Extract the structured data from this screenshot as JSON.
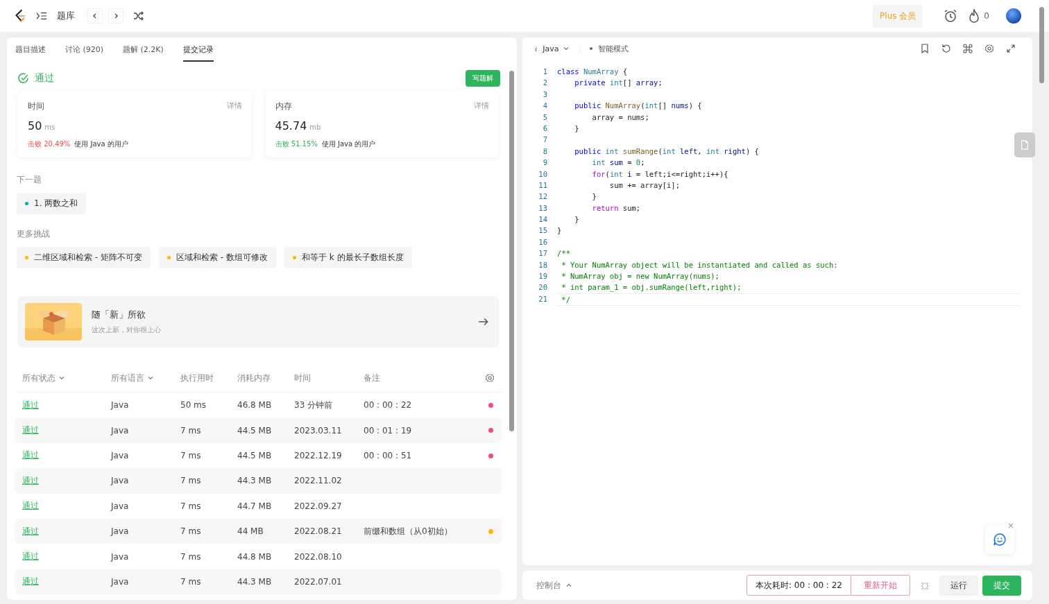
{
  "topbar": {
    "breadcrumb": "题库",
    "plus": "Plus 会员",
    "streak": "0"
  },
  "tabs": [
    {
      "label": "题目描述",
      "selected": false
    },
    {
      "label": "讨论 (920)",
      "selected": false
    },
    {
      "label": "题解 (2.2K)",
      "selected": false
    },
    {
      "label": "提交记录",
      "selected": true
    }
  ],
  "result": {
    "status": "通过",
    "write_button": "写题解"
  },
  "stats": [
    {
      "title": "时间",
      "detail": "详情",
      "value": "50",
      "unit": "ms",
      "beat": "击败 20.49%",
      "color": "#f04b4b",
      "suffix": "使用 Java 的用户"
    },
    {
      "title": "内存",
      "detail": "详情",
      "value": "45.74",
      "unit": "mb",
      "beat": "击败 51.15%",
      "color": "#2db55d",
      "suffix": "使用 Java 的用户"
    }
  ],
  "next": {
    "heading": "下一题",
    "items": [
      {
        "label": "1. 两数之和",
        "color": "#00af9b"
      }
    ]
  },
  "more": {
    "heading": "更多挑战",
    "items": [
      {
        "label": "二维区域和检索 - 矩阵不可变",
        "color": "#ffb800"
      },
      {
        "label": "区域和检索 - 数组可修改",
        "color": "#ffb800"
      },
      {
        "label": "和等于 k 的最长子数组长度",
        "color": "#ffb800"
      }
    ]
  },
  "promo": {
    "title": "随「新」所欲",
    "subtitle": "这次上新，对你很上心"
  },
  "table": {
    "columns": [
      "所有状态",
      "所有语言",
      "执行用时",
      "消耗内存",
      "时间",
      "备注"
    ],
    "rows": [
      {
        "status": "通过",
        "lang": "Java",
        "runtime": "50 ms",
        "memory": "46.8 MB",
        "time": "33 分钟前",
        "note": "00 : 00 : 22",
        "color": "#ef4b8c"
      },
      {
        "status": "通过",
        "lang": "Java",
        "runtime": "7 ms",
        "memory": "44.5 MB",
        "time": "2023.03.11",
        "note": "00 : 01 : 19",
        "color": "#ef4b8c"
      },
      {
        "status": "通过",
        "lang": "Java",
        "runtime": "7 ms",
        "memory": "44.5 MB",
        "time": "2022.12.19",
        "note": "00 : 00 : 51",
        "color": "#ef4b8c"
      },
      {
        "status": "通过",
        "lang": "Java",
        "runtime": "7 ms",
        "memory": "44.3 MB",
        "time": "2022.11.02"
      },
      {
        "status": "通过",
        "lang": "Java",
        "runtime": "7 ms",
        "memory": "44.7 MB",
        "time": "2022.09.27"
      },
      {
        "status": "通过",
        "lang": "Java",
        "runtime": "7 ms",
        "memory": "44 MB",
        "time": "2022.08.21",
        "note": "前缀和数组（从0初始）",
        "color": "#ffb800"
      },
      {
        "status": "通过",
        "lang": "Java",
        "runtime": "7 ms",
        "memory": "44.8 MB",
        "time": "2022.08.10"
      },
      {
        "status": "通过",
        "lang": "Java",
        "runtime": "7 ms",
        "memory": "44.3 MB",
        "time": "2022.07.01"
      }
    ]
  },
  "editor": {
    "info_mark": "i",
    "language": "Java",
    "mode": "智能模式",
    "lines": [
      {
        "number": "1",
        "tokens": [
          {
            "t": "class ",
            "kind": "kw"
          },
          {
            "t": "NumArray",
            "kind": "type"
          },
          {
            "t": " {",
            "kind": "p"
          }
        ]
      },
      {
        "number": "2",
        "tokens": [
          {
            "t": "    private ",
            "kind": "kw"
          },
          {
            "t": "int",
            "kind": "type"
          },
          {
            "t": "[] ",
            "kind": "p"
          },
          {
            "t": "array",
            "kind": "var"
          },
          {
            "t": ";",
            "kind": "p"
          }
        ]
      },
      {
        "number": "3"
      },
      {
        "number": "4",
        "tokens": [
          {
            "t": "    public ",
            "kind": "kw"
          },
          {
            "t": "NumArray",
            "kind": "fn"
          },
          {
            "t": "(",
            "kind": "p"
          },
          {
            "t": "int",
            "kind": "type"
          },
          {
            "t": "[] ",
            "kind": "p"
          },
          {
            "t": "nums",
            "kind": "var"
          },
          {
            "t": ") {",
            "kind": "p"
          }
        ]
      },
      {
        "number": "5",
        "tokens": [
          {
            "t": "        array = nums;",
            "kind": "p"
          }
        ]
      },
      {
        "number": "6",
        "tokens": [
          {
            "t": "    }",
            "kind": "p"
          }
        ]
      },
      {
        "number": "7"
      },
      {
        "number": "8",
        "tokens": [
          {
            "t": "    public ",
            "kind": "kw"
          },
          {
            "t": "int ",
            "kind": "type"
          },
          {
            "t": "sumRange",
            "kind": "fn"
          },
          {
            "t": "(",
            "kind": "p"
          },
          {
            "t": "int ",
            "kind": "type"
          },
          {
            "t": "left",
            "kind": "var"
          },
          {
            "t": ", ",
            "kind": "p"
          },
          {
            "t": "int ",
            "kind": "type"
          },
          {
            "t": "right",
            "kind": "var"
          },
          {
            "t": ") {",
            "kind": "p"
          }
        ]
      },
      {
        "number": "9",
        "tokens": [
          {
            "t": "        int ",
            "kind": "type"
          },
          {
            "t": "sum",
            "kind": "var"
          },
          {
            "t": " = ",
            "kind": "p"
          },
          {
            "t": "0",
            "kind": "num"
          },
          {
            "t": ";",
            "kind": "p"
          }
        ]
      },
      {
        "number": "10",
        "tokens": [
          {
            "t": "        for",
            "kind": "ctrl"
          },
          {
            "t": "(",
            "kind": "p"
          },
          {
            "t": "int ",
            "kind": "type"
          },
          {
            "t": "i",
            "kind": "var"
          },
          {
            "t": " = left;i<=right;i++){",
            "kind": "p"
          }
        ]
      },
      {
        "number": "11",
        "tokens": [
          {
            "t": "            sum += array[i];",
            "kind": "p"
          }
        ]
      },
      {
        "number": "12",
        "tokens": [
          {
            "t": "        }",
            "kind": "p"
          }
        ]
      },
      {
        "number": "13",
        "tokens": [
          {
            "t": "        return ",
            "kind": "ctrl"
          },
          {
            "t": "sum;",
            "kind": "p"
          }
        ]
      },
      {
        "number": "14",
        "tokens": [
          {
            "t": "    }",
            "kind": "p"
          }
        ]
      },
      {
        "number": "15",
        "tokens": [
          {
            "t": "}",
            "kind": "p"
          }
        ]
      },
      {
        "number": "16"
      },
      {
        "number": "17",
        "tokens": [
          {
            "t": "/**",
            "kind": "cmt"
          }
        ]
      },
      {
        "number": "18",
        "tokens": [
          {
            "t": " * Your NumArray object will be instantiated and called as such:",
            "kind": "cmt"
          }
        ]
      },
      {
        "number": "19",
        "tokens": [
          {
            "t": " * NumArray obj = new NumArray(nums);",
            "kind": "cmt"
          }
        ]
      },
      {
        "number": "20",
        "tokens": [
          {
            "t": " * int param_1 = obj.sumRange(left,right);",
            "kind": "cmt"
          }
        ]
      },
      {
        "number": "21",
        "tokens": [
          {
            "t": " */",
            "kind": "cmt"
          }
        ]
      }
    ]
  },
  "console": {
    "label": "控制台",
    "timer": "本次耗时: 00 : 00 : 22",
    "restart": "重新开始",
    "run": "运行",
    "submit": "提交"
  }
}
